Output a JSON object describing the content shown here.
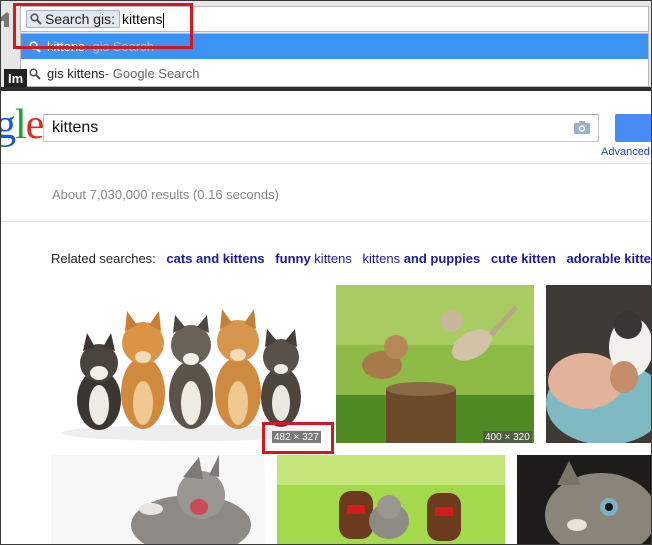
{
  "omnibox": {
    "keyword_label": "Search gis:",
    "query": "kittens"
  },
  "suggestions": [
    {
      "primary": "kittens",
      "secondary": " - gis Search"
    },
    {
      "primary": "gis kittens",
      "secondary": " - Google Search"
    }
  ],
  "tab": {
    "label": "Im"
  },
  "search": {
    "value": "kittens",
    "advanced_label": "Advanced"
  },
  "results": {
    "count_text": "About 7,030,000 results (0.16 seconds)"
  },
  "related": {
    "label": "Related searches:",
    "items": [
      {
        "plain": "",
        "bold": "cats and kittens"
      },
      {
        "bold": "funny",
        "plain": " kittens"
      },
      {
        "plain": "kittens ",
        "bold": "and puppies"
      },
      {
        "plain": "",
        "bold": "cute kitten"
      },
      {
        "plain": "",
        "bold": "adorable kitten"
      }
    ]
  },
  "images": [
    {
      "dimensions": "482 × 327"
    },
    {
      "dimensions": "400 × 320"
    }
  ],
  "colors": {
    "annotation": "#d4181f",
    "suggestion_highlight": "#3d93f1",
    "link": "#1a1aa6"
  }
}
